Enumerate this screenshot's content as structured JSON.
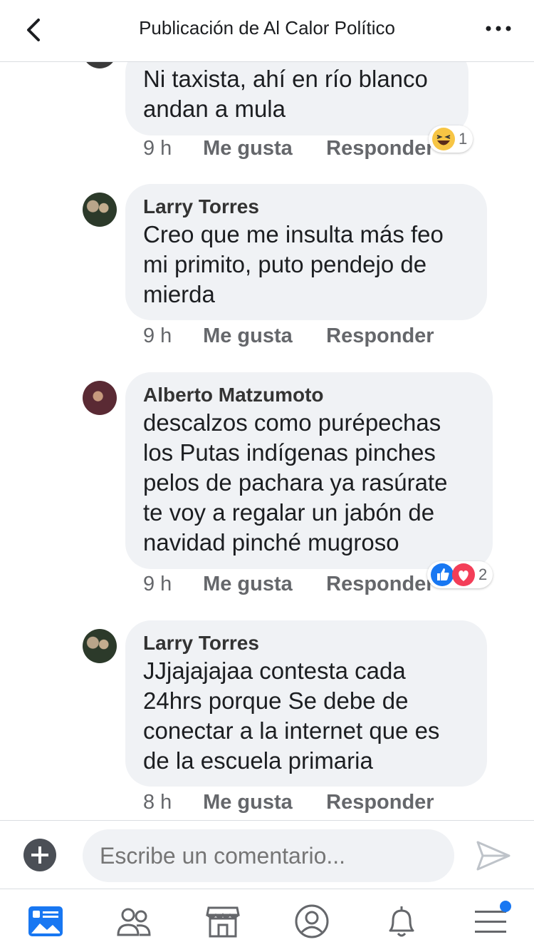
{
  "header": {
    "title": "Publicación de Al Calor Político",
    "back_icon": "chevron-left-icon",
    "more_icon": "ellipsis-icon"
  },
  "comments": [
    {
      "author": "",
      "text": "Ni taxista, ahí en río blanco\nandan a mula",
      "time": "9 h",
      "like": "Me gusta",
      "reply": "Responder",
      "reactions": {
        "icons": [
          "haha-emoji-icon"
        ],
        "count": "1"
      }
    },
    {
      "author": "Larry Torres",
      "text": "Creo que me insulta más feo\nmi primito, puto pendejo de\nmierda",
      "time": "9 h",
      "like": "Me gusta",
      "reply": "Responder"
    },
    {
      "author": "Alberto Matzumoto",
      "text": "descalzos como purépechas\nlos Putas indígenas pinches\npelos de pachara ya rasúrate\nte voy a regalar un jabón de\nnavidad pinché mugroso",
      "time": "9 h",
      "like": "Me gusta",
      "reply": "Responder",
      "reactions": {
        "icons": [
          "like-reaction-icon",
          "love-reaction-icon"
        ],
        "count": "2"
      }
    },
    {
      "author": "Larry Torres",
      "text": "JJjajajajaa contesta cada\n24hrs porque Se debe de\nconectar a la internet que es\nde la escuela primaria",
      "time": "8 h",
      "like": "Me gusta",
      "reply": "Responder"
    }
  ],
  "composer": {
    "placeholder": "Escribe un comentario...",
    "add_icon": "plus-circle-icon",
    "send_icon": "send-icon"
  },
  "tabbar": {
    "items": [
      "news-feed-icon",
      "friends-icon",
      "marketplace-icon",
      "profile-icon",
      "notifications-icon",
      "menu-icon"
    ],
    "active": "news-feed-icon"
  },
  "colors": {
    "accent": "#1877f2",
    "bubble": "#f0f2f5",
    "meta": "#65676b",
    "love": "#f33e58"
  }
}
